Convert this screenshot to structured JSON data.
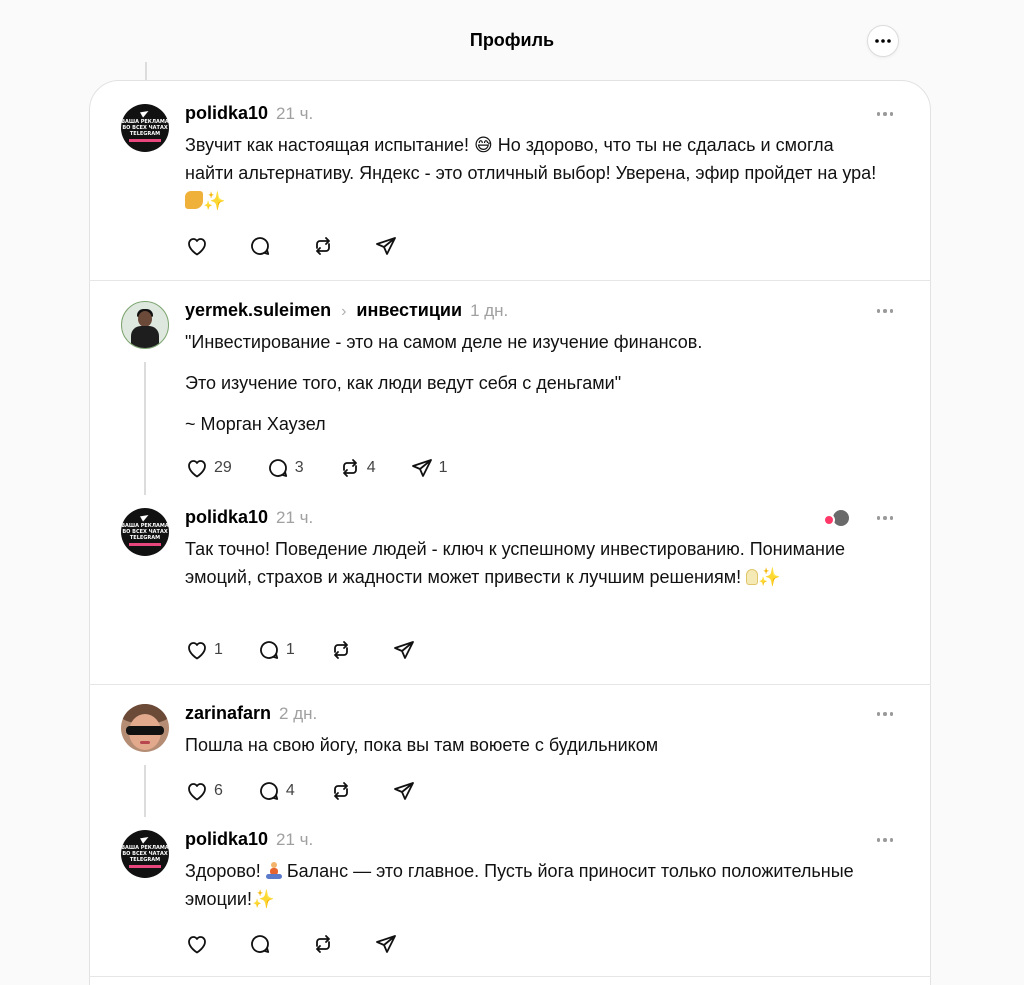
{
  "header": {
    "title": "Профиль",
    "more_icon": "more-horizontal-icon"
  },
  "posts": [
    {
      "username": "polidka10",
      "time": "21 ч.",
      "topic": "",
      "text": [
        "Звучит как настоящая испытание! 😅 Но здорово, что ты не сдалась и смогла найти альтернативу. Яндекс - это отличный выбор! Уверена, эфир пройдет на ура!"
      ],
      "counts": {
        "likes": "",
        "replies": "",
        "reposts": "",
        "shares": ""
      }
    },
    {
      "username": "yermek.suleimen",
      "time": "1 дн.",
      "topic": "инвестиции",
      "text": [
        "\"Инвестирование - это на самом деле не изучение финансов.",
        "Это изучение того, как люди ведут себя с деньгами\"",
        "~ Морган Хаузел"
      ],
      "counts": {
        "likes": "29",
        "replies": "3",
        "reposts": "4",
        "shares": "1"
      }
    },
    {
      "username": "polidka10",
      "time": "21 ч.",
      "topic": "",
      "text": [
        "Так точно! Поведение людей - ключ к успешному инвестированию. Понимание эмоций, страхов и жадности может привести к лучшим решениям!"
      ],
      "counts": {
        "likes": "1",
        "replies": "1",
        "reposts": "",
        "shares": ""
      }
    },
    {
      "username": "zarinafarn",
      "time": "2 дн.",
      "topic": "",
      "text": [
        "Пошла на свою йогу, пока вы там воюете с будильником"
      ],
      "counts": {
        "likes": "6",
        "replies": "4",
        "reposts": "",
        "shares": ""
      }
    },
    {
      "username": "polidka10",
      "time": "21 ч.",
      "topic": "",
      "text": [
        "Здорово!",
        "Баланс — это главное. Пусть йога приносит только положительные эмоции!"
      ],
      "counts": {
        "likes": "",
        "replies": "",
        "reposts": "",
        "shares": ""
      }
    }
  ],
  "avatar_ad_text": "ВАША РЕКЛАМА ВО ВСЕХ ЧАТАХ TELEGRAM",
  "colors": {
    "accent_heart": "#ff3867",
    "muted": "#a0a0a0",
    "divider": "#e6e6e6"
  }
}
